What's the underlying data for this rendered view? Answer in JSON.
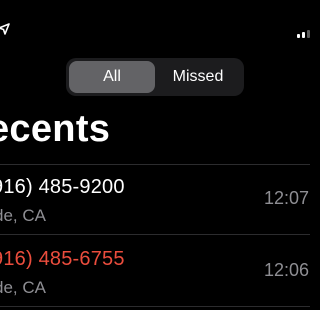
{
  "status_bar": {
    "location_icon": "location-arrow-icon",
    "signal_icon": "cellular-signal-icon"
  },
  "segmented_control": {
    "segments": [
      {
        "label": "All",
        "selected": true
      },
      {
        "label": "Missed",
        "selected": false
      }
    ]
  },
  "page": {
    "title": "ecents"
  },
  "calls": [
    {
      "number": "916) 485-9200",
      "location": "de, CA",
      "time": "12:07",
      "missed": false
    },
    {
      "number": "916) 485-6755",
      "location": "de, CA",
      "time": "12:06",
      "missed": true
    }
  ],
  "colors": {
    "background": "#000000",
    "segment_bg": "#1c1c1e",
    "segment_selected": "#636366",
    "missed_red": "#eb4d3d",
    "secondary_gray": "#8e8e93",
    "divider": "#2c2c2e"
  }
}
